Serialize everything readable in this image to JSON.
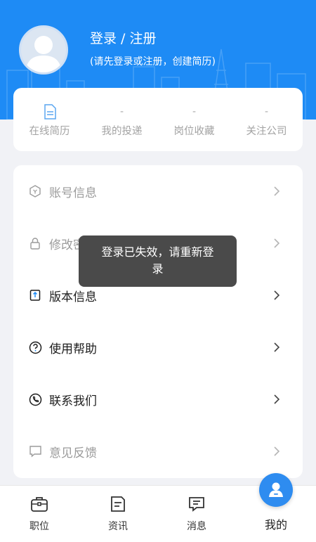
{
  "header": {
    "title": "登录 / 注册",
    "subtitle": "(请先登录或注册，创建简历)"
  },
  "stats": [
    {
      "top": "",
      "label": "在线简历",
      "icon": "resume-icon"
    },
    {
      "top": "-",
      "label": "我的投递"
    },
    {
      "top": "-",
      "label": "岗位收藏"
    },
    {
      "top": "-",
      "label": "关注公司"
    }
  ],
  "menu": [
    {
      "label": "账号信息",
      "icon": "account-info-icon",
      "state": "dim"
    },
    {
      "label": "修改密码",
      "icon": "lock-icon",
      "state": "dim"
    },
    {
      "label": "版本信息",
      "icon": "version-icon",
      "state": "active"
    },
    {
      "label": "使用帮助",
      "icon": "help-icon",
      "state": "active"
    },
    {
      "label": "联系我们",
      "icon": "phone-icon",
      "state": "active"
    },
    {
      "label": "意见反馈",
      "icon": "feedback-icon",
      "state": "dim"
    }
  ],
  "toast": {
    "line1": "登录已失效，请重新登",
    "line2": "录"
  },
  "tabbar": {
    "tabs": [
      {
        "label": "职位",
        "icon": "briefcase-icon"
      },
      {
        "label": "资讯",
        "icon": "news-icon"
      },
      {
        "label": "消息",
        "icon": "message-icon"
      },
      {
        "label": "我的",
        "icon": "profile-icon",
        "active": true
      }
    ]
  },
  "colors": {
    "brand": "#1e8bf5",
    "fab": "#2e8cf0",
    "toast_bg": "#4a4a4a"
  }
}
